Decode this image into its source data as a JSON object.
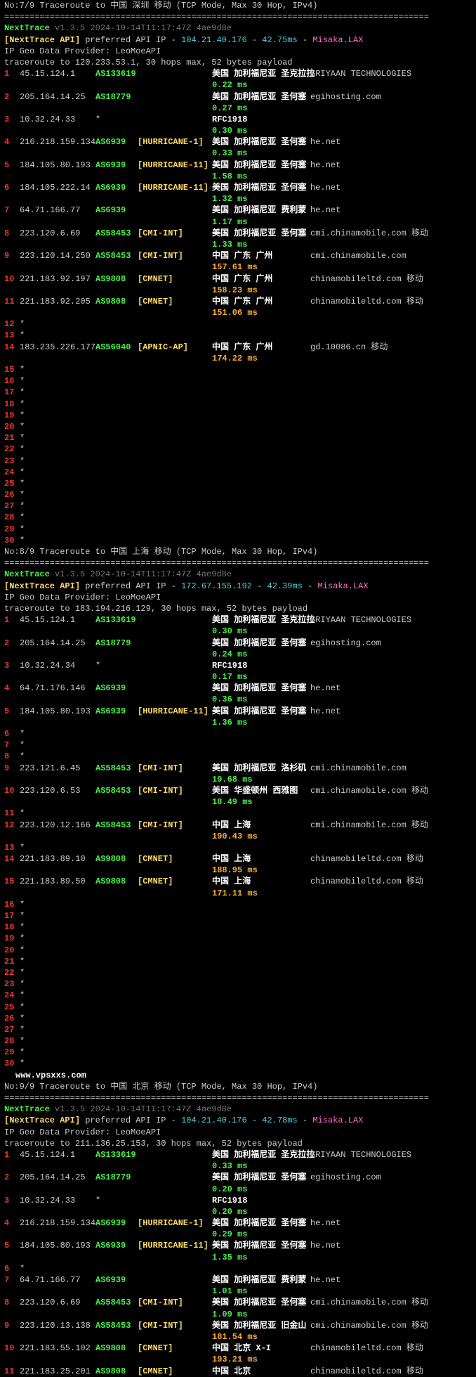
{
  "watermark": "www.vpsxxs.com",
  "divider": "====================================================================================",
  "nexttrace_label": "NextTrace",
  "meta_text": "v1.3.5 2024-10-14T11:17:47Z 4ae9d8e",
  "api_label": "[NextTrace API]",
  "api_prefix": "preferred API IP - ",
  "api_suffix_dash": " - ",
  "misaka": "Misaka.LAX",
  "geo_line": "IP Geo Data Provider: LeoMoeAPI",
  "sections": [
    {
      "title": "No:7/9 Traceroute to 中国 深圳 移动 (TCP Mode, Max 30 Hop, IPv4)",
      "api_ip": "104.21.40.176",
      "api_ms": "42.75ms",
      "trace_line": "traceroute to 120.233.53.1, 30 hops max, 52 bytes payload",
      "rows": [
        {
          "hop": "1",
          "ip": "45.15.124.1",
          "as": "AS133619",
          "tag": "",
          "loc": "美国 加利福尼亚 圣克拉拉",
          "host": "SRIYAAN TECHNOLOGIES",
          "ms": "0.22 ms",
          "ms_color": "green"
        },
        {
          "hop": "2",
          "ip": "205.164.14.25",
          "as": "AS18779",
          "tag": "",
          "loc": "美国 加利福尼亚 圣何塞",
          "host": "egihosting.com",
          "ms": "0.27 ms",
          "ms_color": "green"
        },
        {
          "hop": "3",
          "ip": "10.32.24.33",
          "as": "*",
          "tag": "",
          "loc": "RFC1918",
          "host": "",
          "ms": "0.30 ms",
          "ms_color": "green"
        },
        {
          "hop": "4",
          "ip": "216.218.159.134",
          "as": "AS6939",
          "tag": "[HURRICANE-1]",
          "loc": "美国 加利福尼亚 圣何塞",
          "host": "he.net",
          "ms": "0.33 ms",
          "ms_color": "green"
        },
        {
          "hop": "5",
          "ip": "184.105.80.193",
          "as": "AS6939",
          "tag": "[HURRICANE-11]",
          "loc": "美国 加利福尼亚 圣何塞",
          "host": "he.net",
          "ms": "1.58 ms",
          "ms_color": "green"
        },
        {
          "hop": "6",
          "ip": "184.105.222.14",
          "as": "AS6939",
          "tag": "[HURRICANE-11]",
          "loc": "美国 加利福尼亚 圣何塞",
          "host": "he.net",
          "ms": "1.32 ms",
          "ms_color": "green"
        },
        {
          "hop": "7",
          "ip": "64.71.166.77",
          "as": "AS6939",
          "tag": "",
          "loc": "美国 加利福尼亚 费利蒙",
          "host": "he.net",
          "ms": "1.17 ms",
          "ms_color": "green"
        },
        {
          "hop": "8",
          "ip": "223.120.6.69",
          "as": "AS58453",
          "tag": "[CMI-INT]",
          "loc": "美国 加利福尼亚 圣何塞",
          "host": "cmi.chinamobile.com  移动",
          "ms": "1.33 ms",
          "ms_color": "green"
        },
        {
          "hop": "9",
          "ip": "223.120.14.250",
          "as": "AS58453",
          "tag": "[CMI-INT]",
          "loc": "中国 广东 广州",
          "host": "cmi.chinamobile.com",
          "ms": "157.61 ms",
          "ms_color": "orange"
        },
        {
          "hop": "10",
          "ip": "221.183.92.197",
          "as": "AS9808",
          "tag": "[CMNET]",
          "loc": "中国 广东 广州",
          "host": "chinamobileltd.com  移动",
          "ms": "158.23 ms",
          "ms_color": "orange"
        },
        {
          "hop": "11",
          "ip": "221.183.92.205",
          "as": "AS9808",
          "tag": "[CMNET]",
          "loc": "中国 广东 广州",
          "host": "chinamobileltd.com  移动",
          "ms": "151.06 ms",
          "ms_color": "orange"
        },
        {
          "hop": "12",
          "star": true
        },
        {
          "hop": "13",
          "star": true
        },
        {
          "hop": "14",
          "ip": "183.235.226.177",
          "as": "AS56040",
          "tag": "[APNIC-AP]",
          "loc": "中国 广东 广州",
          "host": "gd.10086.cn  移动",
          "ms": "174.22 ms",
          "ms_color": "orange"
        },
        {
          "hop": "15",
          "star": true
        },
        {
          "hop": "16",
          "star": true
        },
        {
          "hop": "17",
          "star": true
        },
        {
          "hop": "18",
          "star": true
        },
        {
          "hop": "19",
          "star": true
        },
        {
          "hop": "20",
          "star": true
        },
        {
          "hop": "21",
          "star": true
        },
        {
          "hop": "22",
          "star": true
        },
        {
          "hop": "23",
          "star": true
        },
        {
          "hop": "24",
          "star": true
        },
        {
          "hop": "25",
          "star": true
        },
        {
          "hop": "26",
          "star": true
        },
        {
          "hop": "27",
          "star": true
        },
        {
          "hop": "28",
          "star": true
        },
        {
          "hop": "29",
          "star": true
        },
        {
          "hop": "30",
          "star": true
        }
      ]
    },
    {
      "title": "No:8/9 Traceroute to 中国 上海 移动 (TCP Mode, Max 30 Hop, IPv4)",
      "api_ip": "172.67.155.192",
      "api_ms": "42.39ms",
      "trace_line": "traceroute to 183.194.216.129, 30 hops max, 52 bytes payload",
      "rows": [
        {
          "hop": "1",
          "ip": "45.15.124.1",
          "as": "AS133619",
          "tag": "",
          "loc": "美国 加利福尼亚 圣克拉拉",
          "host": "SRIYAAN TECHNOLOGIES",
          "ms": "0.30 ms",
          "ms_color": "green"
        },
        {
          "hop": "2",
          "ip": "205.164.14.25",
          "as": "AS18779",
          "tag": "",
          "loc": "美国 加利福尼亚 圣何塞",
          "host": "egihosting.com",
          "ms": "0.24 ms",
          "ms_color": "green"
        },
        {
          "hop": "3",
          "ip": "10.32.24.34",
          "as": "*",
          "tag": "",
          "loc": "RFC1918",
          "host": "",
          "ms": "0.17 ms",
          "ms_color": "green"
        },
        {
          "hop": "4",
          "ip": "64.71.176.146",
          "as": "AS6939",
          "tag": "",
          "loc": "美国 加利福尼亚 圣何塞",
          "host": "he.net",
          "ms": "0.36 ms",
          "ms_color": "green"
        },
        {
          "hop": "5",
          "ip": "184.105.80.193",
          "as": "AS6939",
          "tag": "[HURRICANE-11]",
          "loc": "美国 加利福尼亚 圣何塞",
          "host": "he.net",
          "ms": "1.36 ms",
          "ms_color": "green"
        },
        {
          "hop": "6",
          "star": true
        },
        {
          "hop": "7",
          "star": true
        },
        {
          "hop": "8",
          "star": true
        },
        {
          "hop": "9",
          "ip": "223.121.6.45",
          "as": "AS58453",
          "tag": "[CMI-INT]",
          "loc": "美国 加利福尼亚 洛杉矶",
          "host": "cmi.chinamobile.com",
          "ms": "19.68 ms",
          "ms_color": "green"
        },
        {
          "hop": "10",
          "ip": "223.120.6.53",
          "as": "AS58453",
          "tag": "[CMI-INT]",
          "loc": "美国 华盛顿州 西雅图",
          "host": "cmi.chinamobile.com  移动",
          "ms": "18.49 ms",
          "ms_color": "green"
        },
        {
          "hop": "11",
          "star": true
        },
        {
          "hop": "12",
          "ip": "223.120.12.166",
          "as": "AS58453",
          "tag": "[CMI-INT]",
          "loc": "中国 上海",
          "host": "cmi.chinamobile.com  移动",
          "ms": "190.43 ms",
          "ms_color": "orange"
        },
        {
          "hop": "13",
          "star": true
        },
        {
          "hop": "14",
          "ip": "221.183.89.10",
          "as": "AS9808",
          "tag": "[CMNET]",
          "loc": "中国 上海",
          "host": "chinamobileltd.com  移动",
          "ms": "188.95 ms",
          "ms_color": "orange"
        },
        {
          "hop": "15",
          "ip": "221.183.89.50",
          "as": "AS9808",
          "tag": "[CMNET]",
          "loc": "中国 上海",
          "host": "chinamobileltd.com  移动",
          "ms": "171.11 ms",
          "ms_color": "orange"
        },
        {
          "hop": "16",
          "star": true
        },
        {
          "hop": "17",
          "star": true
        },
        {
          "hop": "18",
          "star": true
        },
        {
          "hop": "19",
          "star": true
        },
        {
          "hop": "20",
          "star": true
        },
        {
          "hop": "21",
          "star": true
        },
        {
          "hop": "22",
          "star": true
        },
        {
          "hop": "23",
          "star": true
        },
        {
          "hop": "24",
          "star": true
        },
        {
          "hop": "25",
          "star": true
        },
        {
          "hop": "26",
          "star": true
        },
        {
          "hop": "27",
          "star": true
        },
        {
          "hop": "28",
          "star": true
        },
        {
          "hop": "29",
          "star": true
        },
        {
          "hop": "30",
          "star": true
        }
      ]
    },
    {
      "title": "No:9/9 Traceroute to 中国 北京 移动 (TCP Mode, Max 30 Hop, IPv4)",
      "api_ip": "104.21.40.176",
      "api_ms": "42.78ms",
      "trace_line": "traceroute to 211.136.25.153, 30 hops max, 52 bytes payload",
      "rows": [
        {
          "hop": "1",
          "ip": "45.15.124.1",
          "as": "AS133619",
          "tag": "",
          "loc": "美国 加利福尼亚 圣克拉拉",
          "host": "SRIYAAN TECHNOLOGIES",
          "ms": "0.33 ms",
          "ms_color": "green"
        },
        {
          "hop": "2",
          "ip": "205.164.14.25",
          "as": "AS18779",
          "tag": "",
          "loc": "美国 加利福尼亚 圣何塞",
          "host": "egihosting.com",
          "ms": "0.20 ms",
          "ms_color": "green"
        },
        {
          "hop": "3",
          "ip": "10.32.24.33",
          "as": "*",
          "tag": "",
          "loc": "RFC1918",
          "host": "",
          "ms": "0.20 ms",
          "ms_color": "green"
        },
        {
          "hop": "4",
          "ip": "216.218.159.134",
          "as": "AS6939",
          "tag": "[HURRICANE-1]",
          "loc": "美国 加利福尼亚 圣何塞",
          "host": "he.net",
          "ms": "0.29 ms",
          "ms_color": "green"
        },
        {
          "hop": "5",
          "ip": "184.105.80.193",
          "as": "AS6939",
          "tag": "[HURRICANE-11]",
          "loc": "美国 加利福尼亚 圣何塞",
          "host": "he.net",
          "ms": "1.35 ms",
          "ms_color": "green"
        },
        {
          "hop": "6",
          "star": true
        },
        {
          "hop": "7",
          "ip": "64.71.166.77",
          "as": "AS6939",
          "tag": "",
          "loc": "美国 加利福尼亚 费利蒙",
          "host": "he.net",
          "ms": "1.01 ms",
          "ms_color": "green"
        },
        {
          "hop": "8",
          "ip": "223.120.6.69",
          "as": "AS58453",
          "tag": "[CMI-INT]",
          "loc": "美国 加利福尼亚 圣何塞",
          "host": "cmi.chinamobile.com  移动",
          "ms": "1.09 ms",
          "ms_color": "green"
        },
        {
          "hop": "9",
          "ip": "223.120.13.138",
          "as": "AS58453",
          "tag": "[CMI-INT]",
          "loc": "美国 加利福尼亚 旧金山",
          "host": "cmi.chinamobile.com  移动",
          "ms": "181.54 ms",
          "ms_color": "orange"
        },
        {
          "hop": "10",
          "ip": "221.183.55.102",
          "as": "AS9808",
          "tag": "[CMNET]",
          "loc": "中国 北京  X-I",
          "host": "chinamobileltd.com  移动",
          "ms": "193.21 ms",
          "ms_color": "orange"
        },
        {
          "hop": "11",
          "ip": "221.183.25.201",
          "as": "AS9808",
          "tag": "[CMNET]",
          "loc": "中国 北京",
          "host": "chinamobileltd.com  移动",
          "ms": "",
          "ms_color": "orange",
          "nomstop": true
        }
      ]
    }
  ]
}
